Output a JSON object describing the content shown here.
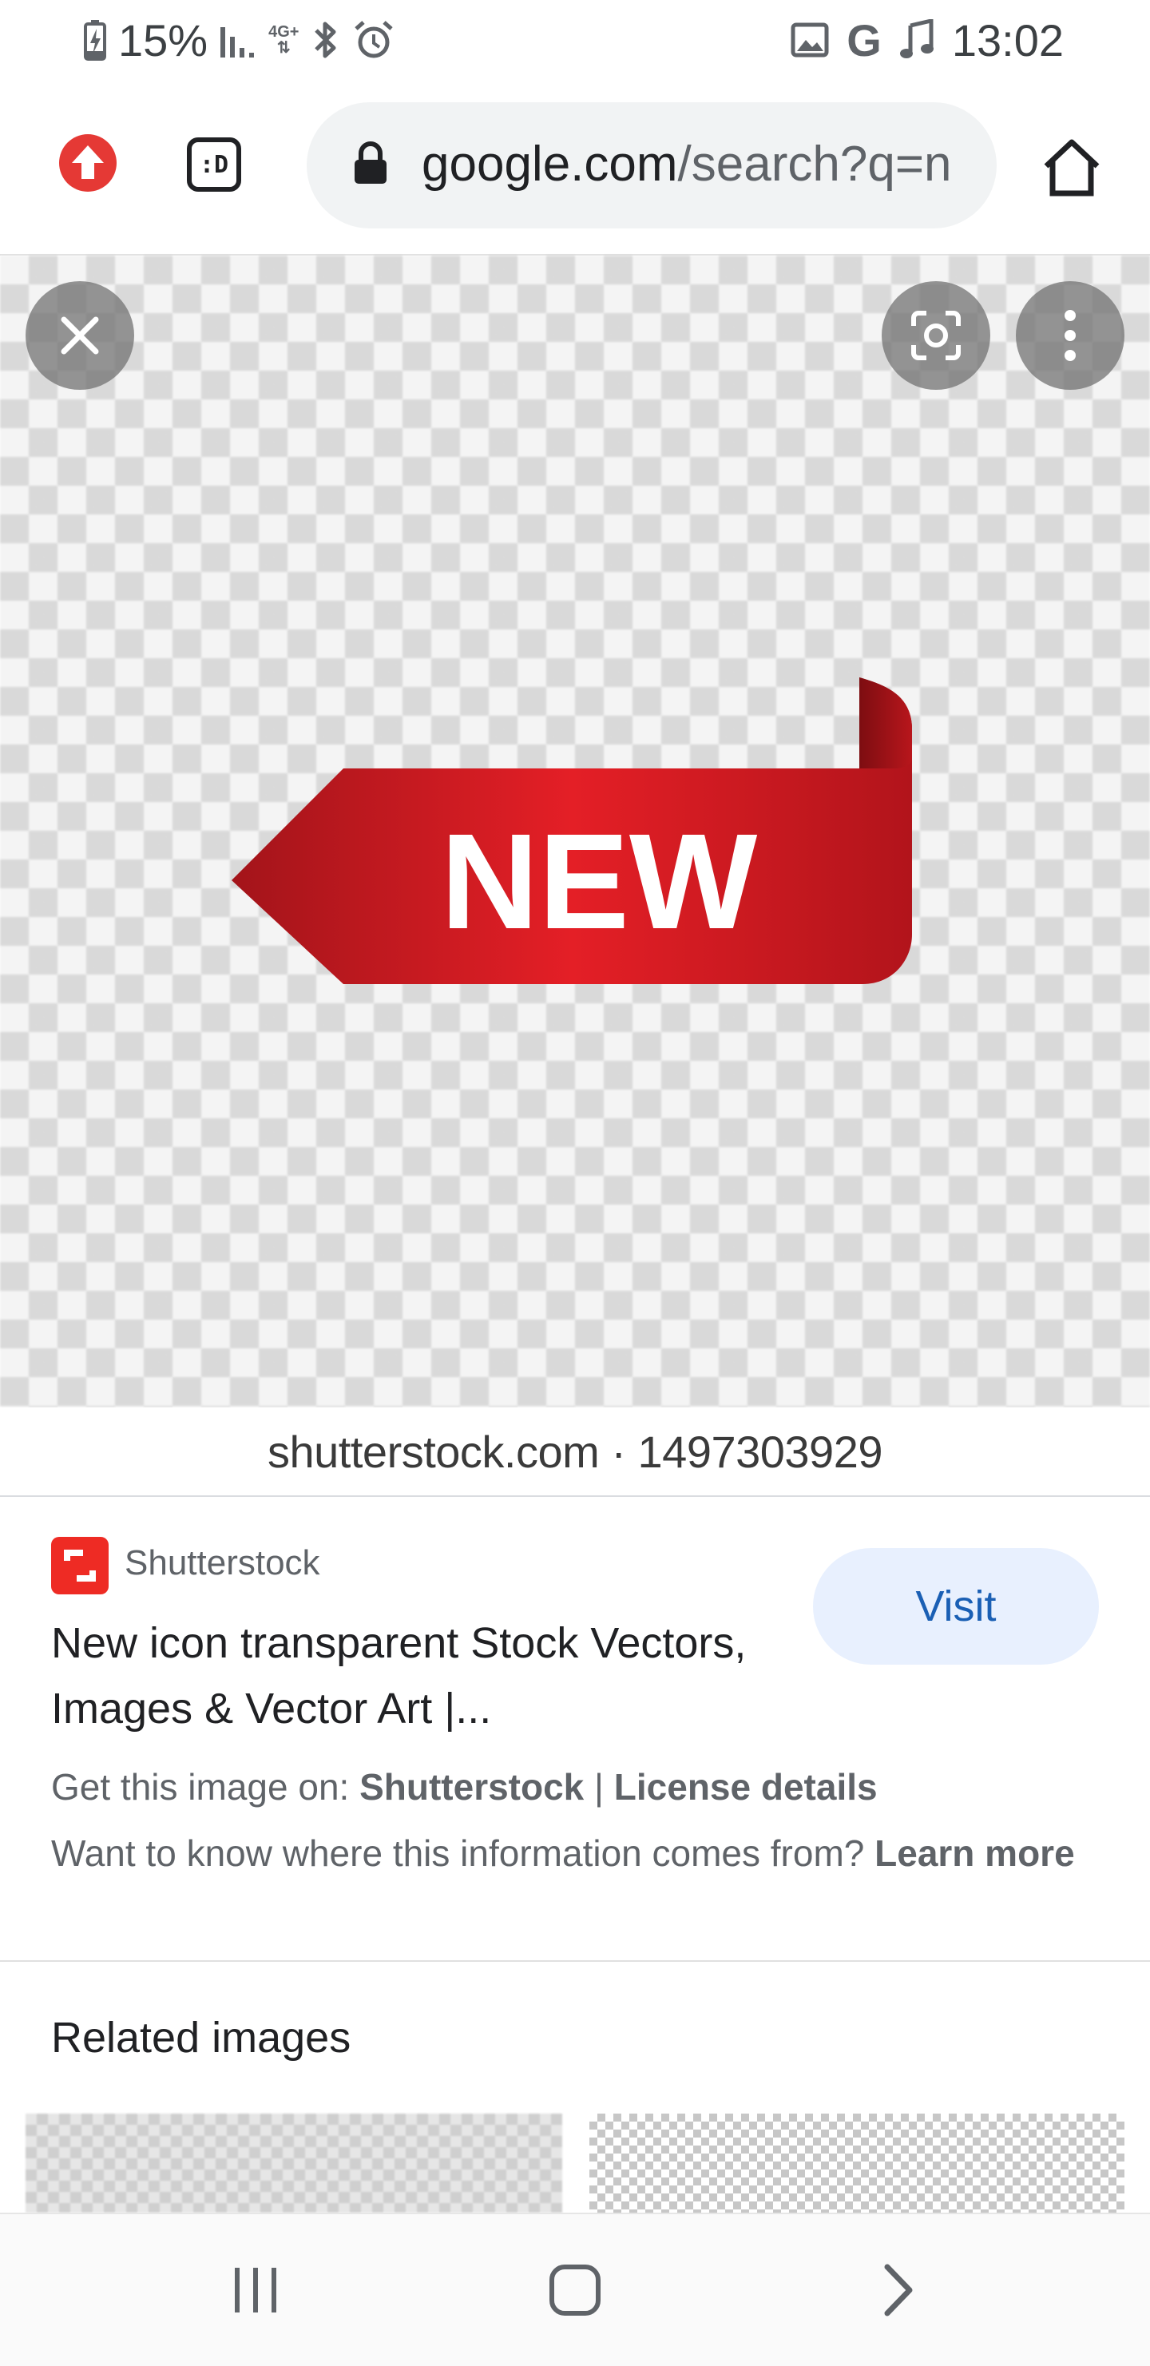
{
  "status_bar": {
    "battery": "15%",
    "network_type": "4G+",
    "time": "13:02"
  },
  "toolbar": {
    "url_host": "google.com",
    "url_path": "/search?q=n"
  },
  "viewer": {
    "image_text": "NEW",
    "credit": "shutterstock.com · 1497303929"
  },
  "result": {
    "source_name": "Shutterstock",
    "visit_label": "Visit",
    "title": "New icon transparent Stock Vectors, Images & Vector Art |...",
    "get_image_prefix": "Get this image on: ",
    "get_image_source": "Shutterstock",
    "separator": " | ",
    "license_label": "License details",
    "info_question": "Want to know where this information comes from? ",
    "learn_more": "Learn more"
  },
  "related": {
    "heading": "Related images"
  },
  "colors": {
    "accent_blue": "#1a5fb4",
    "visit_bg": "#e8f0fe",
    "ribbon_red": "#d71920",
    "shutterstock_red": "#ee2b24"
  }
}
